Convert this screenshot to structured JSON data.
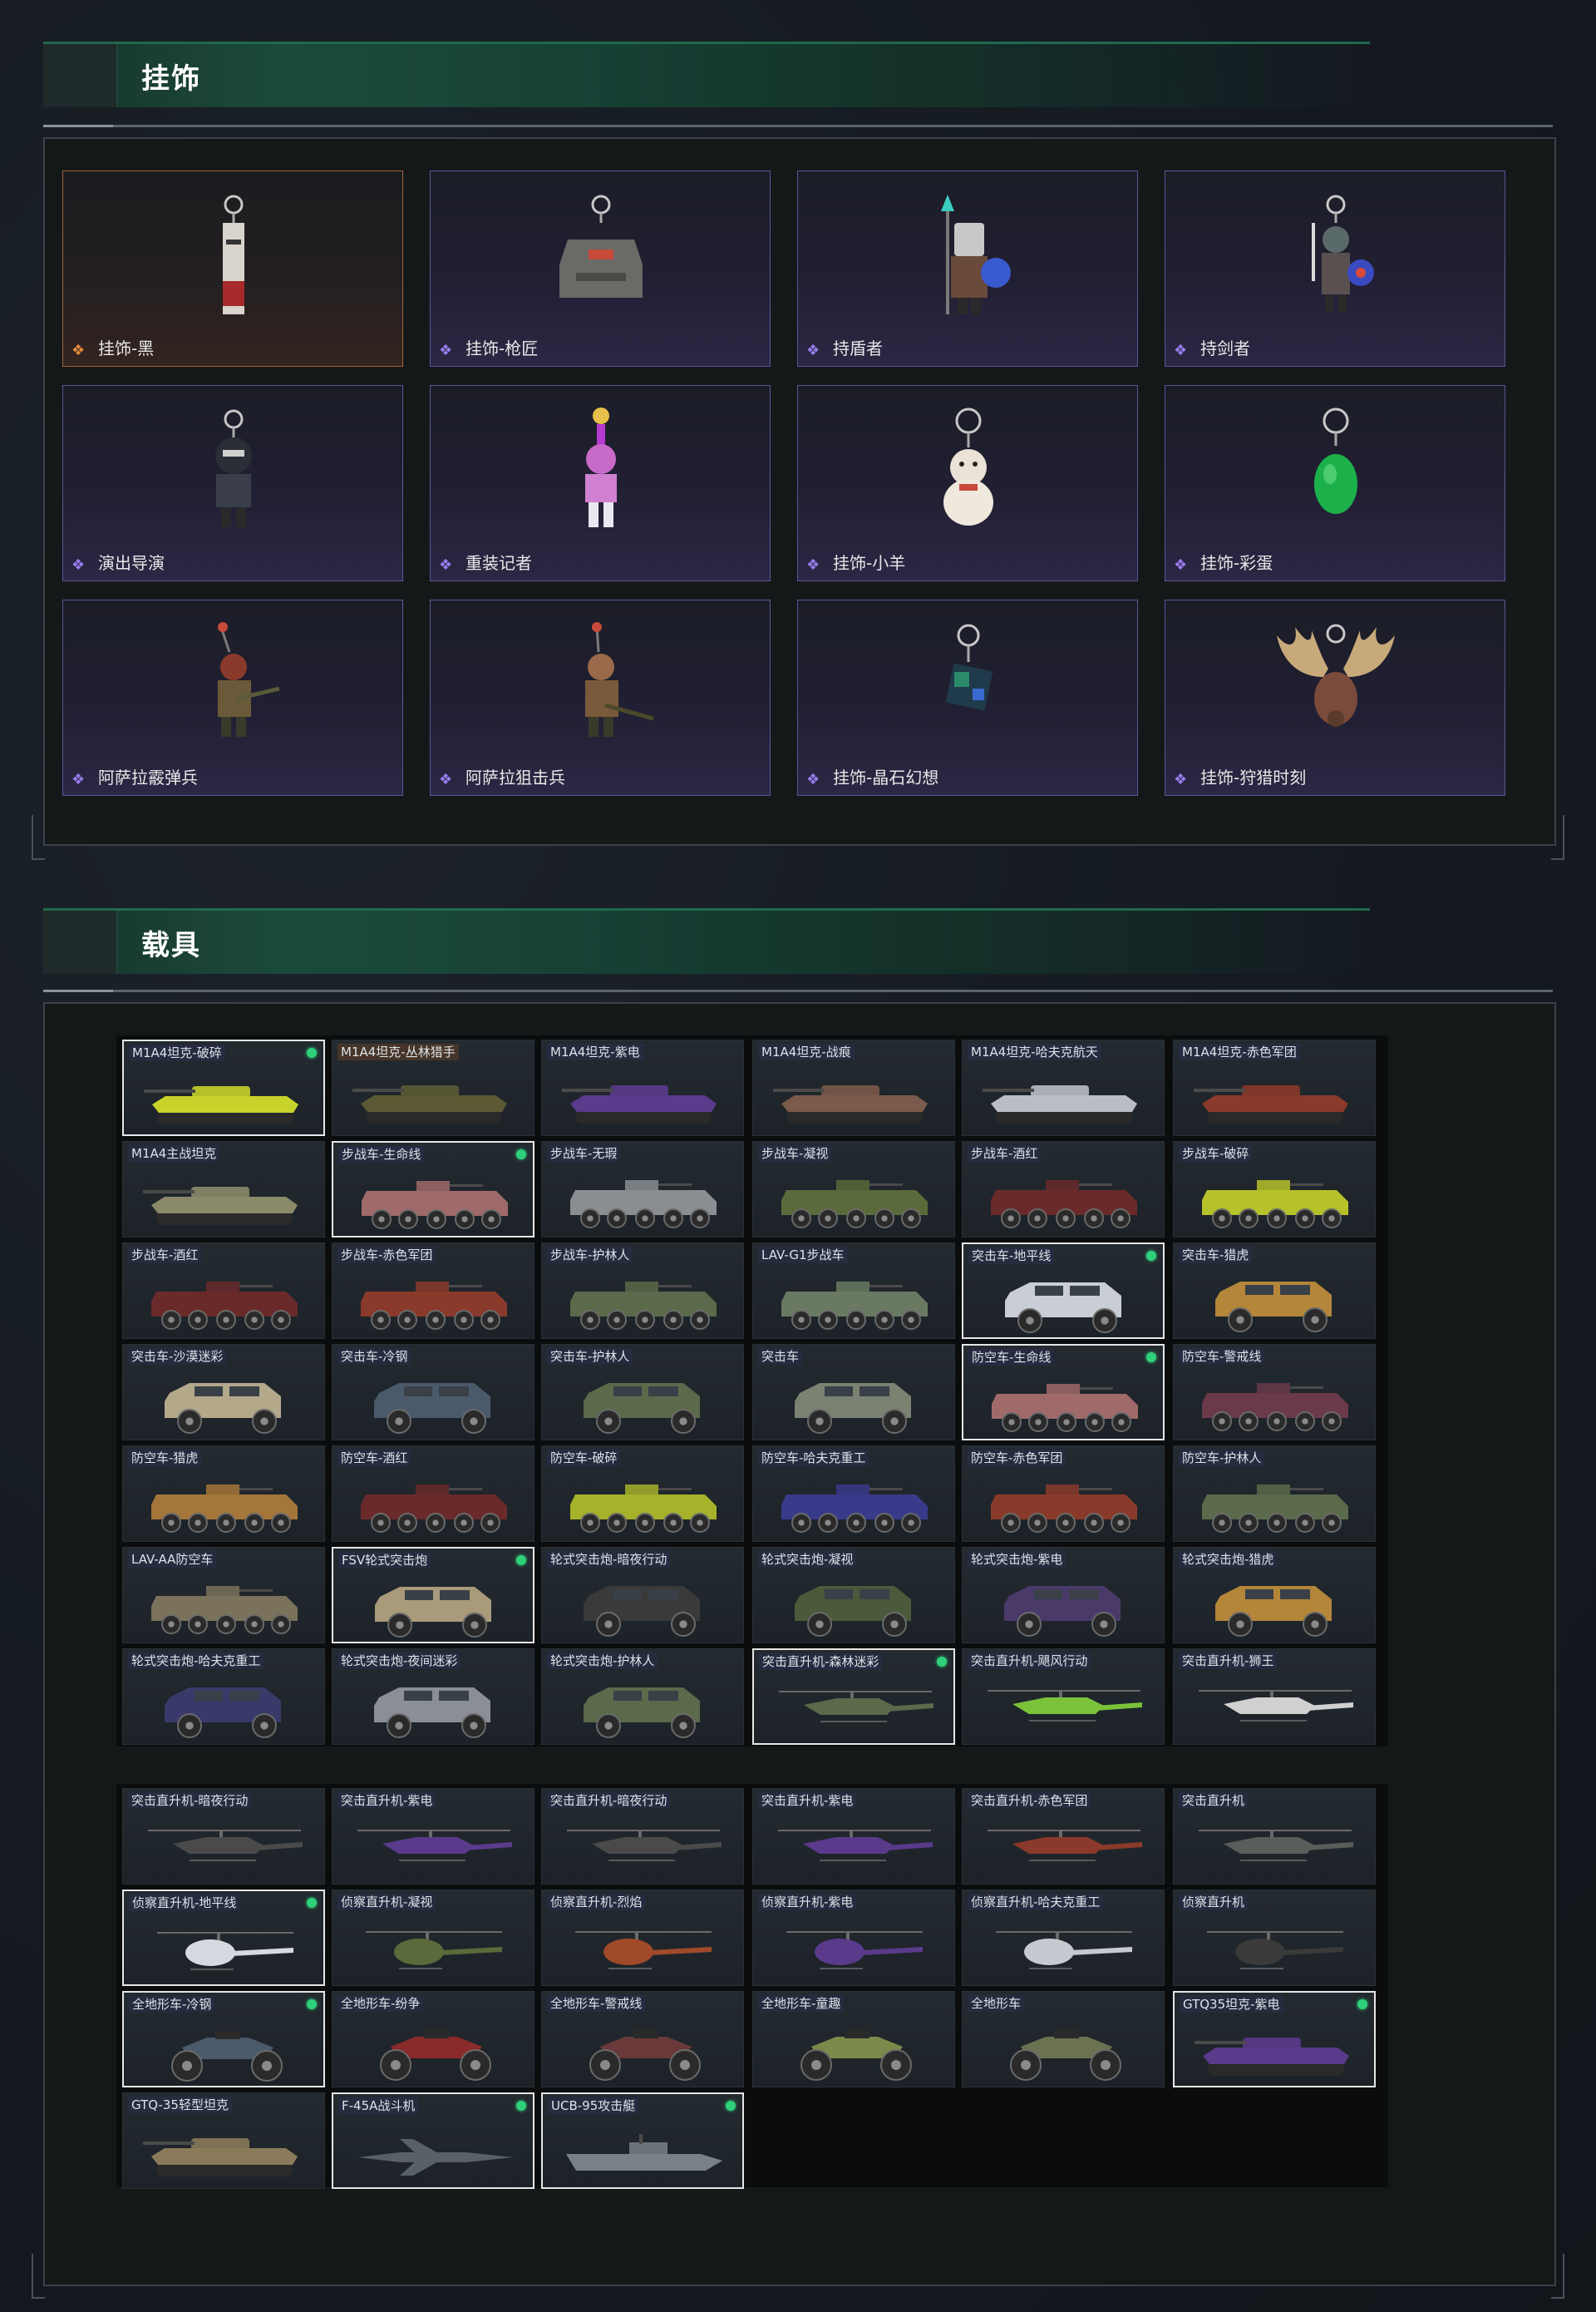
{
  "sections": {
    "charms": {
      "title": "挂饰",
      "items": [
        {
          "label": "挂饰-黑",
          "rarity": "orange",
          "icon": "charm-black-tag-icon"
        },
        {
          "label": "挂饰-枪匠",
          "rarity": "purple",
          "icon": "charm-gunsmith-icon"
        },
        {
          "label": "持盾者",
          "rarity": "purple",
          "icon": "charm-shield-bearer-icon"
        },
        {
          "label": "持剑者",
          "rarity": "purple",
          "icon": "charm-swordsman-icon"
        },
        {
          "label": "演出导演",
          "rarity": "purple",
          "icon": "charm-show-director-icon"
        },
        {
          "label": "重装记者",
          "rarity": "purple",
          "icon": "charm-heavy-reporter-icon"
        },
        {
          "label": "挂饰-小羊",
          "rarity": "purple",
          "icon": "charm-lamb-icon"
        },
        {
          "label": "挂饰-彩蛋",
          "rarity": "purple",
          "icon": "charm-easter-egg-icon"
        },
        {
          "label": "阿萨拉霰弹兵",
          "rarity": "purple",
          "icon": "charm-shotgunner-icon"
        },
        {
          "label": "阿萨拉狙击兵",
          "rarity": "purple",
          "icon": "charm-sniper-icon"
        },
        {
          "label": "挂饰-晶石幻想",
          "rarity": "purple",
          "icon": "charm-crystal-cube-icon"
        },
        {
          "label": "挂饰-狩猎时刻",
          "rarity": "purple",
          "icon": "charm-antlers-icon"
        }
      ]
    },
    "vehicles": {
      "title": "载具",
      "group1": [
        {
          "label": "M1A4坦克-破碎",
          "type": "tank",
          "color": "#c7d32a",
          "selected": true
        },
        {
          "label": "M1A4坦克-丛林猎手",
          "type": "tank",
          "color": "#5b5a34",
          "tag": "orange"
        },
        {
          "label": "M1A4坦克-紫电",
          "type": "tank",
          "color": "#5a3b8c"
        },
        {
          "label": "M1A4坦克-战痕",
          "type": "tank",
          "color": "#7a5a4a"
        },
        {
          "label": "M1A4坦克-哈夫克航天",
          "type": "tank",
          "color": "#b9bec6"
        },
        {
          "label": "M1A4坦克-赤色军团",
          "type": "tank",
          "color": "#8a3a2a"
        },
        {
          "label": "M1A4主战坦克",
          "type": "tank",
          "color": "#8a8a6a"
        },
        {
          "label": "步战车-生命线",
          "type": "ifv",
          "color": "#a06a6a",
          "selected": true
        },
        {
          "label": "步战车-无瑕",
          "type": "ifv",
          "color": "#8a8e92"
        },
        {
          "label": "步战车-凝视",
          "type": "ifv",
          "color": "#5a6a3a"
        },
        {
          "label": "步战车-酒红",
          "type": "ifv",
          "color": "#6a2a2a"
        },
        {
          "label": "步战车-破碎",
          "type": "ifv",
          "color": "#b6c22a"
        },
        {
          "label": "步战车-酒红",
          "type": "ifv",
          "color": "#6a2a2a"
        },
        {
          "label": "步战车-赤色军团",
          "type": "ifv",
          "color": "#8a3a2a"
        },
        {
          "label": "步战车-护林人",
          "type": "ifv",
          "color": "#5a6a4a"
        },
        {
          "label": "LAV-G1步战车",
          "type": "ifv",
          "color": "#6a7a62"
        },
        {
          "label": "突击车-地平线",
          "type": "suv",
          "color": "#c9ced6",
          "selected": true
        },
        {
          "label": "突击车-猎虎",
          "type": "suv",
          "color": "#b4863a"
        },
        {
          "label": "突击车-沙漠迷彩",
          "type": "suv",
          "color": "#b4a88a"
        },
        {
          "label": "突击车-冷钢",
          "type": "suv",
          "color": "#4a5a6a"
        },
        {
          "label": "突击车-护林人",
          "type": "suv",
          "color": "#5a6a4a"
        },
        {
          "label": "突击车",
          "type": "suv",
          "color": "#7a8272"
        },
        {
          "label": "防空车-生命线",
          "type": "ifv",
          "color": "#a06a6a",
          "selected": true
        },
        {
          "label": "防空车-警戒线",
          "type": "ifv",
          "color": "#6a3a4a"
        },
        {
          "label": "防空车-猎虎",
          "type": "ifv",
          "color": "#a4763a"
        },
        {
          "label": "防空车-酒红",
          "type": "ifv",
          "color": "#6a2a2a"
        },
        {
          "label": "防空车-破碎",
          "type": "ifv",
          "color": "#a6b22a"
        },
        {
          "label": "防空车-哈夫克重工",
          "type": "ifv",
          "color": "#3a3a8a"
        },
        {
          "label": "防空车-赤色军团",
          "type": "ifv",
          "color": "#8a3a2a"
        },
        {
          "label": "防空车-护林人",
          "type": "ifv",
          "color": "#5a6a4a"
        },
        {
          "label": "LAV-AA防空车",
          "type": "ifv",
          "color": "#7a725a"
        },
        {
          "label": "FSV轮式突击炮",
          "type": "suv",
          "color": "#a89a7a",
          "selected": true
        },
        {
          "label": "轮式突击炮-暗夜行动",
          "type": "suv",
          "color": "#3a3a3a"
        },
        {
          "label": "轮式突击炮-凝视",
          "type": "suv",
          "color": "#4a5a3a"
        },
        {
          "label": "轮式突击炮-紫电",
          "type": "suv",
          "color": "#4a3a6a"
        },
        {
          "label": "轮式突击炮-猎虎",
          "type": "suv",
          "color": "#b4863a"
        },
        {
          "label": "轮式突击炮-哈夫克重工",
          "type": "suv",
          "color": "#3a3a6a"
        },
        {
          "label": "轮式突击炮-夜间迷彩",
          "type": "suv",
          "color": "#8a8e96"
        },
        {
          "label": "轮式突击炮-护林人",
          "type": "suv",
          "color": "#5a6a4a"
        },
        {
          "label": "突击直升机-森林迷彩",
          "type": "heli",
          "color": "#5a6a4a",
          "selected": true
        },
        {
          "label": "突击直升机-飓风行动",
          "type": "heli",
          "color": "#7ac23a"
        },
        {
          "label": "突击直升机-狮王",
          "type": "heli",
          "color": "#d0d0d0"
        }
      ],
      "group2": [
        {
          "label": "突击直升机-暗夜行动",
          "type": "heli",
          "color": "#4a4a4a"
        },
        {
          "label": "突击直升机-紫电",
          "type": "heli",
          "color": "#5a3a8a"
        },
        {
          "label": "突击直升机-暗夜行动",
          "type": "heli",
          "color": "#4a4a4a"
        },
        {
          "label": "突击直升机-紫电",
          "type": "heli",
          "color": "#5a3a8a"
        },
        {
          "label": "突击直升机-赤色军团",
          "type": "heli",
          "color": "#8a3a2a"
        },
        {
          "label": "突击直升机",
          "type": "heli",
          "color": "#5a5e5a"
        },
        {
          "label": "侦察直升机-地平线",
          "type": "scout",
          "color": "#d6dae0",
          "selected": true
        },
        {
          "label": "侦察直升机-凝视",
          "type": "scout",
          "color": "#5a6a3a"
        },
        {
          "label": "侦察直升机-烈焰",
          "type": "scout",
          "color": "#a04a2a"
        },
        {
          "label": "侦察直升机-紫电",
          "type": "scout",
          "color": "#5a3a8a"
        },
        {
          "label": "侦察直升机-哈夫克重工",
          "type": "scout",
          "color": "#c6cad0"
        },
        {
          "label": "侦察直升机",
          "type": "scout",
          "color": "#3a3a3a"
        },
        {
          "label": "全地形车-冷钢",
          "type": "atv",
          "color": "#4a5a6a",
          "selected": true
        },
        {
          "label": "全地形车-纷争",
          "type": "atv",
          "color": "#8a2a2a"
        },
        {
          "label": "全地形车-警戒线",
          "type": "atv",
          "color": "#6a3a3a"
        },
        {
          "label": "全地形车-童趣",
          "type": "atv",
          "color": "#7a8a4a"
        },
        {
          "label": "全地形车",
          "type": "atv",
          "color": "#6a7252"
        },
        {
          "label": "GTQ35坦克-紫电",
          "type": "tank",
          "color": "#5a3a8a",
          "selected": true
        },
        {
          "label": "GTQ-35轻型坦克",
          "type": "tank",
          "color": "#8a7a5a"
        },
        {
          "label": "F-45A战斗机",
          "type": "jet",
          "color": "#5a6068",
          "selected": true
        },
        {
          "label": "UCB-95攻击艇",
          "type": "boat",
          "color": "#7a8088",
          "selected": true
        }
      ]
    }
  }
}
